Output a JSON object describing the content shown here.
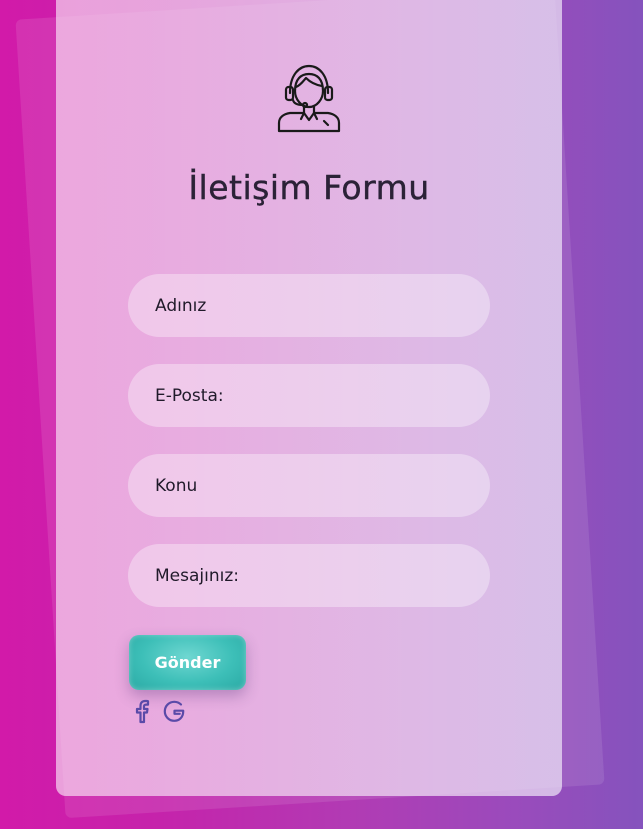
{
  "form": {
    "title": "İletişim Formu",
    "fields": [
      {
        "placeholder": "Adınız",
        "value": ""
      },
      {
        "placeholder": "E-Posta:",
        "value": ""
      },
      {
        "placeholder": "Konu",
        "value": ""
      },
      {
        "placeholder": "Mesajınız:",
        "value": ""
      }
    ],
    "submit_label": "Gönder"
  },
  "icons": {
    "header": "customer-support-agent-icon",
    "social": [
      "facebook-icon",
      "google-icon"
    ]
  },
  "colors": {
    "accent_button": "#3dbfb8",
    "social_icon": "#5a4aa8",
    "text": "#2b2237"
  }
}
